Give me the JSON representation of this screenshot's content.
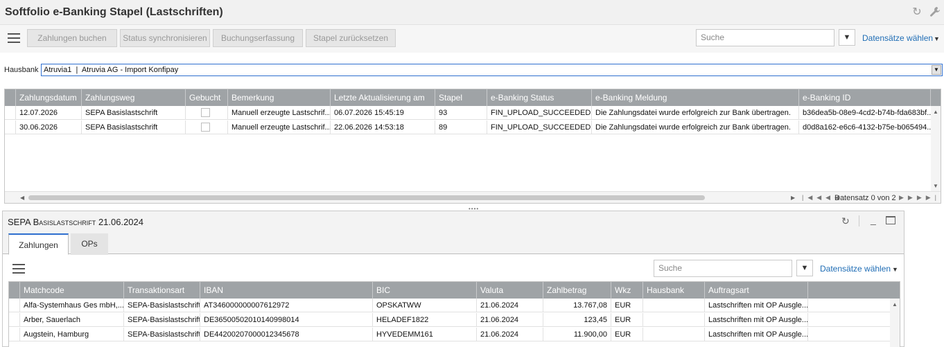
{
  "app": {
    "title": "Softfolio e-Banking Stapel (Lastschriften)",
    "icons": [
      "refresh-icon",
      "wrench-icon"
    ]
  },
  "toolbar": {
    "buttons": [
      "Zahlungen buchen",
      "Status synchronisieren",
      "Buchungserfassung",
      "Stapel zurücksetzen"
    ],
    "search_placeholder": "Suche",
    "datasets_label": "Datensätze wählen"
  },
  "hausbank": {
    "label": "Hausbank",
    "value": "Atruvia1  |  Atruvia AG - Import Konfipay"
  },
  "batch_grid": {
    "columns": [
      "Zahlungsdatum",
      "Zahlungsweg",
      "Gebucht",
      "Bemerkung",
      "Letzte Aktualisierung am",
      "Stapel",
      "e-Banking Status",
      "e-Banking Meldung",
      "e-Banking ID"
    ],
    "rows": [
      {
        "datum": "12.07.2026",
        "weg": "SEPA Basislastschrift",
        "gebucht": false,
        "bemerkung": "Manuell erzeugte Lastschrif...",
        "aktualisiert": "06.07.2026 15:45:19",
        "stapel": "93",
        "status": "FIN_UPLOAD_SUCCEEDED",
        "meldung": "Die Zahlungsdatei wurde erfolgreich zur Bank übertragen.",
        "id": "b36dea5b-08e9-4cd2-b74b-fda683bf..."
      },
      {
        "datum": "30.06.2026",
        "weg": "SEPA Basislastschrift",
        "gebucht": false,
        "bemerkung": "Manuell erzeugte Lastschrif...",
        "aktualisiert": "22.06.2026 14:53:18",
        "stapel": "89",
        "status": "FIN_UPLOAD_SUCCEEDED",
        "meldung": "Die Zahlungsdatei wurde erfolgreich zur Bank übertragen.",
        "id": "d0d8a162-e6c6-4132-b75e-b065494..."
      }
    ],
    "pager_text": "Datensatz 0 von 2"
  },
  "detail": {
    "title_prefix": "SEPA Basislastschrift",
    "title_date": "21.06.2024",
    "tabs": [
      "Zahlungen",
      "OPs"
    ],
    "active_tab": "Zahlungen",
    "search_placeholder": "Suche",
    "datasets_label": "Datensätze wählen",
    "columns": [
      "Matchcode",
      "Transaktionsart",
      "IBAN",
      "BIC",
      "Valuta",
      "Zahlbetrag",
      "Wkz",
      "Hausbank",
      "Auftragsart"
    ],
    "rows": [
      {
        "matchcode": "Alfa-Systemhaus Ges mbH,...",
        "art": "SEPA-Basislastschrift",
        "iban": "AT346000000007612972",
        "bic": "OPSKATWW",
        "valuta": "21.06.2024",
        "betrag": "13.767,08",
        "wkz": "EUR",
        "hausbank": "",
        "auftrag": "Lastschriften mit OP Ausgle..."
      },
      {
        "matchcode": "Arber, Sauerlach",
        "art": "SEPA-Basislastschrift",
        "iban": "DE36500502010140998014",
        "bic": "HELADEF1822",
        "valuta": "21.06.2024",
        "betrag": "123,45",
        "wkz": "EUR",
        "hausbank": "",
        "auftrag": "Lastschriften mit OP Ausgle..."
      },
      {
        "matchcode": "Augstein, Hamburg",
        "art": "SEPA-Basislastschrift",
        "iban": "DE44200207000012345678",
        "bic": "HYVEDEMM161",
        "valuta": "21.06.2024",
        "betrag": "11.900,00",
        "wkz": "EUR",
        "hausbank": "",
        "auftrag": "Lastschriften mit OP Ausgle..."
      }
    ]
  },
  "colors": {
    "accent": "#1f6db5",
    "grid_header": "#9fa3a6",
    "focus_border": "#2f6fcf"
  }
}
